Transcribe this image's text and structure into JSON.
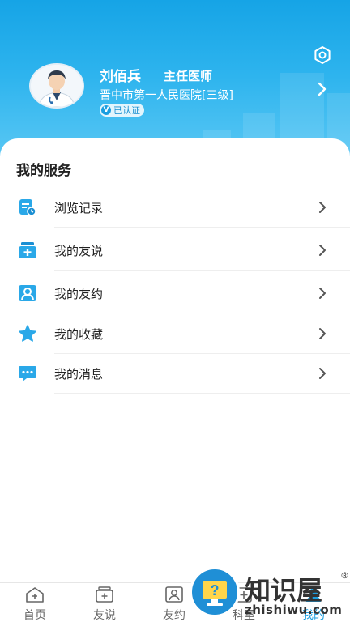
{
  "profile": {
    "name": "刘佰兵",
    "title": "主任医师",
    "hospital": "晋中市第一人民医院[三级]",
    "verified_mark": "V",
    "verified_label": "已认证"
  },
  "services": {
    "title": "我的服务",
    "items": [
      {
        "label": "浏览记录",
        "icon": "history-icon"
      },
      {
        "label": "我的友说",
        "icon": "post-icon"
      },
      {
        "label": "我的友约",
        "icon": "appointment-icon"
      },
      {
        "label": "我的收藏",
        "icon": "star-icon"
      },
      {
        "label": "我的消息",
        "icon": "message-icon"
      }
    ]
  },
  "tabbar": {
    "tabs": [
      {
        "label": "首页",
        "icon": "home-icon"
      },
      {
        "label": "友说",
        "icon": "post-icon"
      },
      {
        "label": "友约",
        "icon": "appointment-icon"
      },
      {
        "label": "科室",
        "icon": "department-icon"
      },
      {
        "label": "我的",
        "icon": "profile-icon",
        "active": true
      }
    ]
  },
  "watermark": {
    "text": "知识屋",
    "reg": "®",
    "url": "zhishiwu.com",
    "mark": "?"
  },
  "colors": {
    "accent": "#1a9ee0",
    "header_top": "#16a4e6",
    "header_bottom": "#5fcaf5"
  }
}
